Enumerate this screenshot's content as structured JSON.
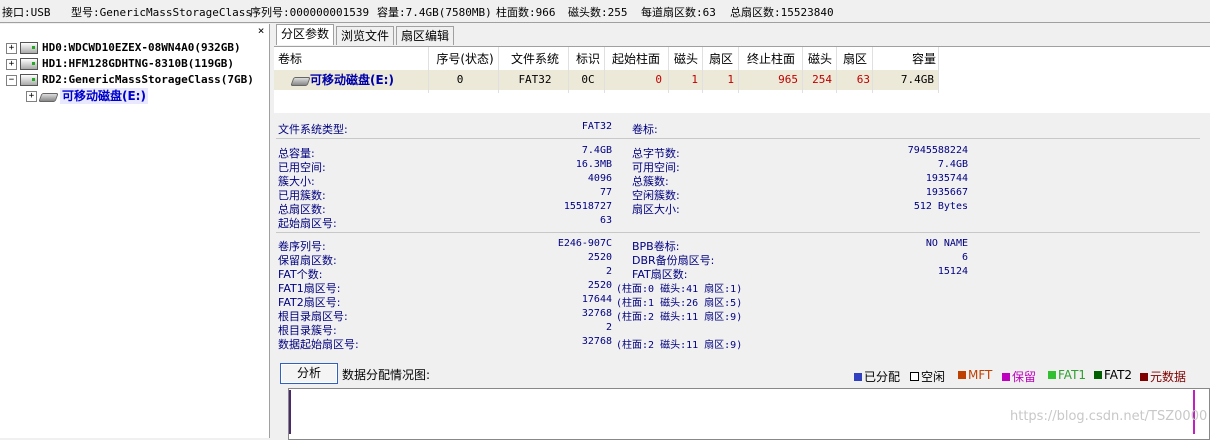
{
  "info_bar": {
    "interface": "接口:USB",
    "model": "型号:GenericMassStorageClass",
    "serial": "序列号:000000001539",
    "capacity": "容量:7.4GB(7580MB)",
    "cylinders": "柱面数:966",
    "heads": "磁头数:255",
    "sectors_per_track": "每道扇区数:63",
    "total_sectors": "总扇区数:15523840"
  },
  "tree": {
    "close_glyph": "×",
    "items": [
      {
        "label": "HD0:WDCWD10EZEX-08WN4A0(932GB)",
        "expander": "+"
      },
      {
        "label": "HD1:HFM128GDHTNG-8310B(119GB)",
        "expander": "+"
      },
      {
        "label": "RD2:GenericMassStorageClass(7GB)",
        "expander": "−"
      },
      {
        "label": "可移动磁盘(E:)",
        "expander": "+"
      }
    ]
  },
  "tabs": [
    "分区参数",
    "浏览文件",
    "扇区编辑"
  ],
  "grid": {
    "headers": [
      "卷标",
      "序号(状态)",
      "文件系统",
      "标识",
      "起始柱面",
      "磁头",
      "扇区",
      "终止柱面",
      "磁头",
      "扇区",
      "容量"
    ],
    "row": [
      "可移动磁盘(E:)",
      "0",
      "FAT32",
      "0C",
      "0",
      "1",
      "1",
      "965",
      "254",
      "63",
      "7.4GB"
    ]
  },
  "details": {
    "fs_type_label": "文件系统类型:",
    "fs_type_value": "FAT32",
    "volume_label_label": "卷标:",
    "left_group1": [
      {
        "label": "总容量:",
        "value": "7.4GB"
      },
      {
        "label": "已用空间:",
        "value": "16.3MB"
      },
      {
        "label": "簇大小:",
        "value": "4096"
      },
      {
        "label": "已用簇数:",
        "value": "77"
      },
      {
        "label": "总扇区数:",
        "value": "15518727"
      },
      {
        "label": "起始扇区号:",
        "value": "63"
      }
    ],
    "right_group1": [
      {
        "label": "总字节数:",
        "value": "7945588224"
      },
      {
        "label": "可用空间:",
        "value": "7.4GB"
      },
      {
        "label": "总簇数:",
        "value": "1935744"
      },
      {
        "label": "空闲簇数:",
        "value": "1935667"
      },
      {
        "label": "扇区大小:",
        "value": "512 Bytes"
      }
    ],
    "left_group2": [
      {
        "label": "卷序列号:",
        "value": "E246-907C"
      },
      {
        "label": "保留扇区数:",
        "value": "2520"
      },
      {
        "label": "FAT个数:",
        "value": "2"
      },
      {
        "label": "FAT1扇区号:",
        "value": "2520"
      },
      {
        "label": "FAT2扇区号:",
        "value": "17644"
      },
      {
        "label": "根目录扇区号:",
        "value": "32768"
      },
      {
        "label": "根目录簇号:",
        "value": "2"
      },
      {
        "label": "数据起始扇区号:",
        "value": "32768"
      }
    ],
    "chs_notes": [
      "(柱面:0 磁头:41 扇区:1)",
      "(柱面:1 磁头:26 扇区:5)",
      "(柱面:2 磁头:11 扇区:9)",
      "(柱面:2 磁头:11 扇区:9)"
    ],
    "right_group2": [
      {
        "label": "BPB卷标:",
        "value": "NO NAME"
      },
      {
        "label": "DBR备份扇区号:",
        "value": "6"
      },
      {
        "label": "FAT扇区数:",
        "value": "15124"
      }
    ]
  },
  "analysis": {
    "button_label": "分析",
    "map_label": "数据分配情况图:",
    "legend": [
      {
        "label": "已分配",
        "color": "#3040c0",
        "text_color": "#000000"
      },
      {
        "label": "空闲",
        "color": "#ffffff",
        "text_color": "#000000"
      },
      {
        "label": "MFT",
        "color": "#c04000",
        "text_color": "#c04000"
      },
      {
        "label": "保留",
        "color": "#c000c0",
        "text_color": "#c000c0"
      },
      {
        "label": "FAT1",
        "color": "#30c030",
        "text_color": "#30a030"
      },
      {
        "label": "FAT2",
        "color": "#006000",
        "text_color": "#000000"
      },
      {
        "label": "元数据",
        "color": "#800000",
        "text_color": "#800000"
      }
    ]
  },
  "watermark": "https://blog.csdn.net/TSZ0000"
}
